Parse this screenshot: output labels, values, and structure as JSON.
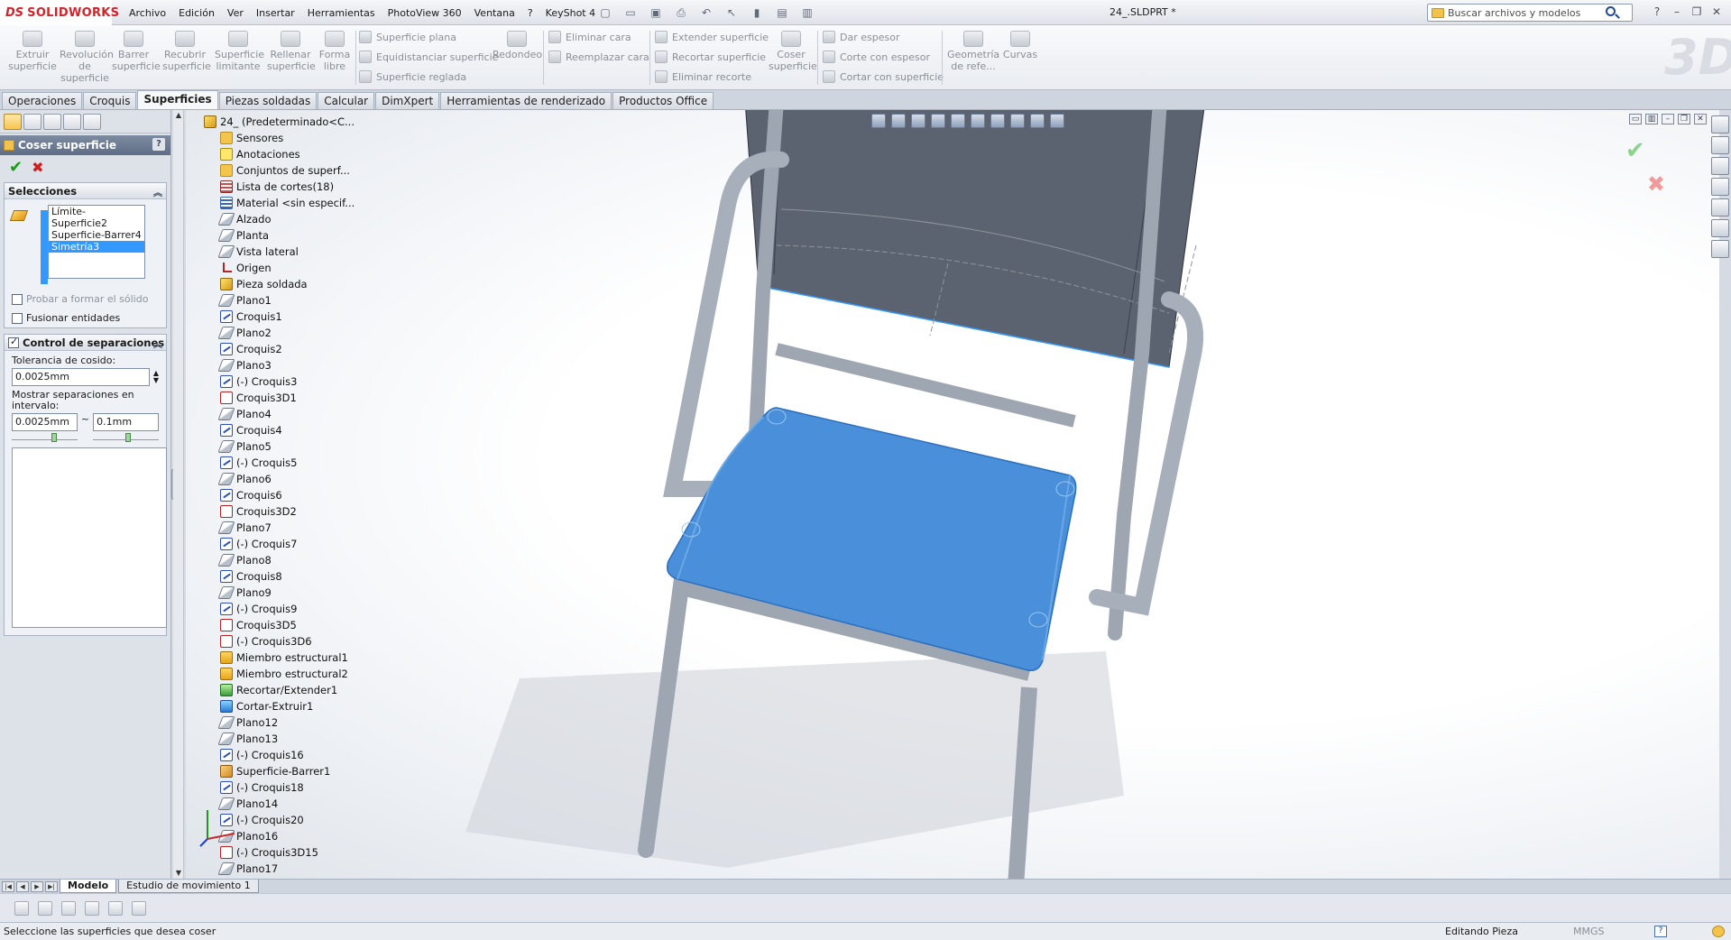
{
  "app": {
    "logo_prefix": "DS",
    "logo_text": "SOLIDWORKS",
    "doc_title": "24_.SLDPRT *",
    "search_placeholder": "Buscar archivos y modelos",
    "menu": [
      "Archivo",
      "Edición",
      "Ver",
      "Insertar",
      "Herramientas",
      "PhotoView 360",
      "Ventana",
      "?",
      "KeyShot 4"
    ]
  },
  "ribbon": {
    "large_buttons": [
      {
        "label": "Extruir superficie"
      },
      {
        "label": "Revolución de superficie"
      },
      {
        "label": "Barrer superficie"
      },
      {
        "label": "Recubrir superficie"
      },
      {
        "label": "Superficie limitante"
      },
      {
        "label": "Rellenar superficie"
      },
      {
        "label": "Forma libre"
      }
    ],
    "col1": [
      "Superficie plana",
      "Equidistanciar superficie",
      "Superficie reglada"
    ],
    "redondeo": "Redondeo",
    "col2": [
      "Eliminar cara",
      "Reemplazar cara"
    ],
    "col3": [
      "Extender superficie",
      "Recortar superficie",
      "Eliminar recorte"
    ],
    "coser": "Coser superficie",
    "col4": [
      "Dar espesor",
      "Corte con espesor",
      "Cortar con superficie"
    ],
    "geometria": "Geometría de refe...",
    "curvas": "Curvas"
  },
  "tabs": [
    "Operaciones",
    "Croquis",
    "Superficies",
    "Piezas soldadas",
    "Calcular",
    "DimXpert",
    "Herramientas de renderizado",
    "Productos Office"
  ],
  "active_tab": "Superficies",
  "property_manager": {
    "title": "Coser superficie",
    "help": "?",
    "selections_header": "Selecciones",
    "selections": [
      "Límite-Superficie2",
      "Superficie-Barrer4",
      "Simetría3"
    ],
    "selected_index": 2,
    "probar_label": "Probar a formar el sólido",
    "probar_checked": false,
    "fusionar_label": "Fusionar entidades",
    "fusionar_checked": false,
    "gap_header": "Control de separaciones",
    "gap_checked": true,
    "tolerance_label": "Tolerancia de cosido:",
    "tolerance_value": "0.0025mm",
    "range_label": "Mostrar separaciones en intervalo:",
    "range_min": "0.0025mm",
    "range_sep": "~",
    "range_max": "0.1mm"
  },
  "feature_tree": {
    "root": "24_ (Predeterminado<C...",
    "items": [
      {
        "icon": "folder",
        "label": "Sensores"
      },
      {
        "icon": "ann",
        "label": "Anotaciones"
      },
      {
        "icon": "folder",
        "label": "Conjuntos de superf..."
      },
      {
        "icon": "list",
        "label": "Lista de cortes(18)"
      },
      {
        "icon": "mat",
        "label": "Material <sin especif..."
      },
      {
        "icon": "plane",
        "label": "Alzado"
      },
      {
        "icon": "plane",
        "label": "Planta"
      },
      {
        "icon": "plane",
        "label": "Vista lateral"
      },
      {
        "icon": "origin",
        "label": "Origen"
      },
      {
        "icon": "part",
        "label": "Pieza soldada"
      },
      {
        "icon": "plane",
        "label": "Plano1"
      },
      {
        "icon": "sketch",
        "label": "Croquis1"
      },
      {
        "icon": "plane",
        "label": "Plano2"
      },
      {
        "icon": "sketch",
        "label": "Croquis2"
      },
      {
        "icon": "plane",
        "label": "Plano3"
      },
      {
        "icon": "sketch",
        "label": "(-) Croquis3"
      },
      {
        "icon": "3d",
        "label": "Croquis3D1"
      },
      {
        "icon": "plane",
        "label": "Plano4"
      },
      {
        "icon": "sketch",
        "label": "Croquis4"
      },
      {
        "icon": "plane",
        "label": "Plano5"
      },
      {
        "icon": "sketch",
        "label": "(-) Croquis5"
      },
      {
        "icon": "plane",
        "label": "Plano6"
      },
      {
        "icon": "sketch",
        "label": "Croquis6"
      },
      {
        "icon": "3d",
        "label": "Croquis3D2"
      },
      {
        "icon": "plane",
        "label": "Plano7"
      },
      {
        "icon": "sketch",
        "label": "(-) Croquis7"
      },
      {
        "icon": "plane",
        "label": "Plano8"
      },
      {
        "icon": "sketch",
        "label": "Croquis8"
      },
      {
        "icon": "plane",
        "label": "Plano9"
      },
      {
        "icon": "sketch",
        "label": "(-) Croquis9"
      },
      {
        "icon": "3d",
        "label": "Croquis3D5"
      },
      {
        "icon": "3d",
        "label": "(-) Croquis3D6"
      },
      {
        "icon": "member",
        "label": "Miembro estructural1"
      },
      {
        "icon": "member",
        "label": "Miembro estructural2"
      },
      {
        "icon": "trim",
        "label": "Recortar/Extender1"
      },
      {
        "icon": "cut",
        "label": "Cortar-Extruir1"
      },
      {
        "icon": "plane",
        "label": "Plano12"
      },
      {
        "icon": "plane",
        "label": "Plano13"
      },
      {
        "icon": "sketch",
        "label": "(-) Croquis16"
      },
      {
        "icon": "surf",
        "label": "Superficie-Barrer1"
      },
      {
        "icon": "sketch",
        "label": "(-) Croquis18"
      },
      {
        "icon": "plane",
        "label": "Plano14"
      },
      {
        "icon": "sketch",
        "label": "(-) Croquis20"
      },
      {
        "icon": "plane",
        "label": "Plano16"
      },
      {
        "icon": "3d",
        "label": "(-) Croquis3D15"
      },
      {
        "icon": "plane",
        "label": "Plano17"
      }
    ]
  },
  "bottom_tabs": [
    "Modelo",
    "Estudio de movimiento 1"
  ],
  "status": {
    "message": "Seleccione las superficies que desea coser",
    "mode": "Editando Pieza",
    "units": "MMGS",
    "help": "?"
  },
  "colors": {
    "accent_blue": "#3399ff",
    "surface_blue": "#4a8fd9",
    "frame_gray": "#9ea6b2",
    "backrest": "#5b6270",
    "logo_red": "#d2232a"
  }
}
